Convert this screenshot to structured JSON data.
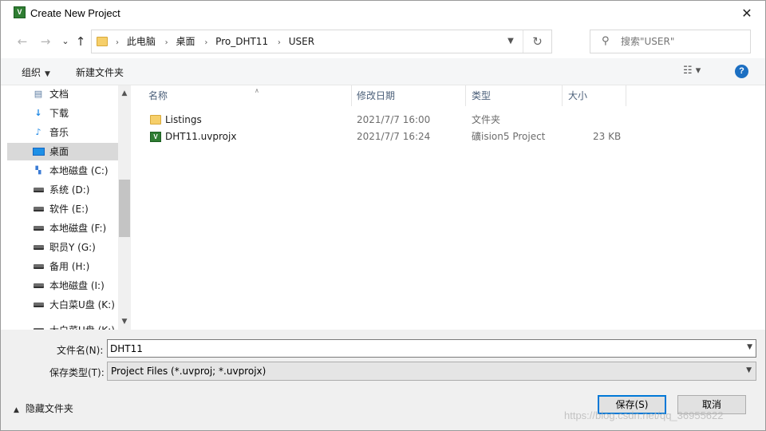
{
  "window": {
    "title": "Create New Project",
    "app_icon_text": "V",
    "close_glyph": "✕"
  },
  "nav": {
    "back_glyph": "←",
    "forward_glyph": "→",
    "dropdown_glyph": "⌄",
    "up_glyph": "↑",
    "breadcrumbs": [
      "此电脑",
      "桌面",
      "Pro_DHT11",
      "USER"
    ],
    "crumb_separator": "›",
    "refresh_glyph": "↻",
    "search_placeholder": "搜索\"USER\""
  },
  "toolbar": {
    "organize_label": "组织",
    "new_folder_label": "新建文件夹",
    "view_glyph": "☷ ▾",
    "help_glyph": "?"
  },
  "sidebar": {
    "items": [
      {
        "label": "文档",
        "icon": "document-icon"
      },
      {
        "label": "下载",
        "icon": "download-icon"
      },
      {
        "label": "音乐",
        "icon": "music-icon"
      },
      {
        "label": "桌面",
        "icon": "desktop-icon",
        "selected": true
      },
      {
        "label": "本地磁盘 (C:)",
        "icon": "drive-icon"
      },
      {
        "label": "系统 (D:)",
        "icon": "drive-icon"
      },
      {
        "label": "软件 (E:)",
        "icon": "drive-icon"
      },
      {
        "label": "本地磁盘 (F:)",
        "icon": "drive-icon"
      },
      {
        "label": "职员Y (G:)",
        "icon": "drive-icon"
      },
      {
        "label": "备用 (H:)",
        "icon": "drive-icon"
      },
      {
        "label": "本地磁盘 (I:)",
        "icon": "drive-icon"
      },
      {
        "label": "大白菜U盘 (K:)",
        "icon": "drive-icon"
      },
      {
        "label": "大白菜U盘 (K:)",
        "icon": "drive-icon"
      }
    ]
  },
  "filelist": {
    "columns": [
      "名称",
      "修改日期",
      "类型",
      "大小"
    ],
    "rows": [
      {
        "name": "Listings",
        "date": "2021/7/7 16:00",
        "type": "文件夹",
        "size": "",
        "icon": "folder-icon"
      },
      {
        "name": "DHT11.uvprojx",
        "date": "2021/7/7 16:24",
        "type": "礦ision5 Project",
        "size": "23 KB",
        "icon": "uvision-project-icon"
      }
    ]
  },
  "bottom": {
    "filename_label": "文件名(N):",
    "filename_value": "DHT11",
    "filetype_label": "保存类型(T):",
    "filetype_value": "Project Files (*.uvproj; *.uvprojx)",
    "hide_folders_label": "隐藏文件夹",
    "save_label": "保存(S)",
    "cancel_label": "取消",
    "watermark": "https://blog.csdn.net/qq_36955622"
  },
  "colors": {
    "accent": "#0078d7",
    "selected_bg": "#d9d9d9",
    "folder": "#f6cf6a",
    "uvision_green": "#2f7d32"
  }
}
